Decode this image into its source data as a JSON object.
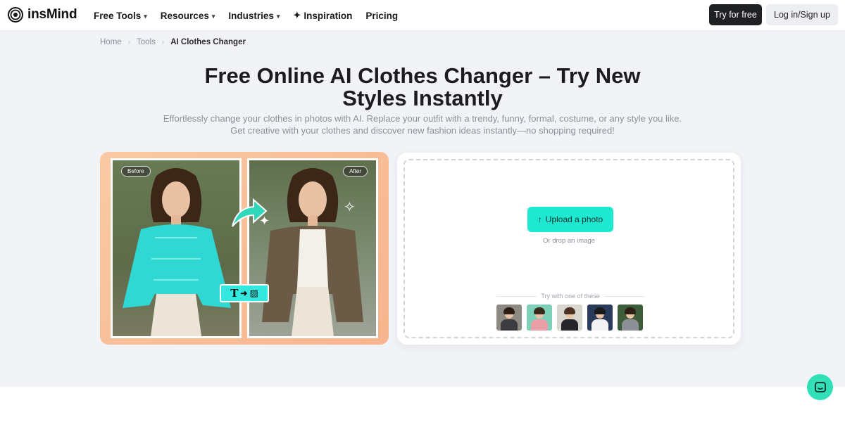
{
  "header": {
    "logo_text": "insMind",
    "nav": [
      {
        "label": "Free Tools",
        "has_dropdown": true
      },
      {
        "label": "Resources",
        "has_dropdown": true
      },
      {
        "label": "Industries",
        "has_dropdown": true
      },
      {
        "label": "Inspiration",
        "icon": "sparkle-icon"
      },
      {
        "label": "Pricing"
      }
    ],
    "try_free_label": "Try for free",
    "login_label": "Log in/Sign up"
  },
  "breadcrumb": {
    "home": "Home",
    "tools": "Tools",
    "current": "AI Clothes Changer"
  },
  "hero": {
    "title": "Free Online AI Clothes Changer – Try New Styles Instantly",
    "subtitle": "Effortlessly change your clothes in photos with AI. Replace your outfit with a trendy, funny, formal, costume, or any style you like. Get creative with your clothes and discover new fashion ideas instantly—no shopping required!"
  },
  "showcase": {
    "before_label": "Before",
    "after_label": "After",
    "badge_text": "T",
    "colors": {
      "before_top": "#2fd8d3",
      "after_jacket": "#6b5a45",
      "gradient": "#f8bf98"
    }
  },
  "upload": {
    "button_label": "Upload a photo",
    "drop_hint": "Or drop an image",
    "try_label": "Try with one of these",
    "samples": [
      {
        "name": "sample-1",
        "outfit": "#3c3c40",
        "bg": "#8d8a84"
      },
      {
        "name": "sample-2",
        "outfit": "#e8a0a6",
        "bg": "#7fd0b8"
      },
      {
        "name": "sample-3",
        "outfit": "#26262a",
        "bg": "#d9d5cf"
      },
      {
        "name": "sample-4",
        "outfit": "#f2f2f2",
        "bg": "#2a3b5c"
      },
      {
        "name": "sample-5",
        "outfit": "#8c8f96",
        "bg": "#3d5c3a"
      }
    ]
  },
  "colors": {
    "accent": "#1ee8d0",
    "dark_button": "#1f2024",
    "hero_bg": "#f1f3f7"
  }
}
